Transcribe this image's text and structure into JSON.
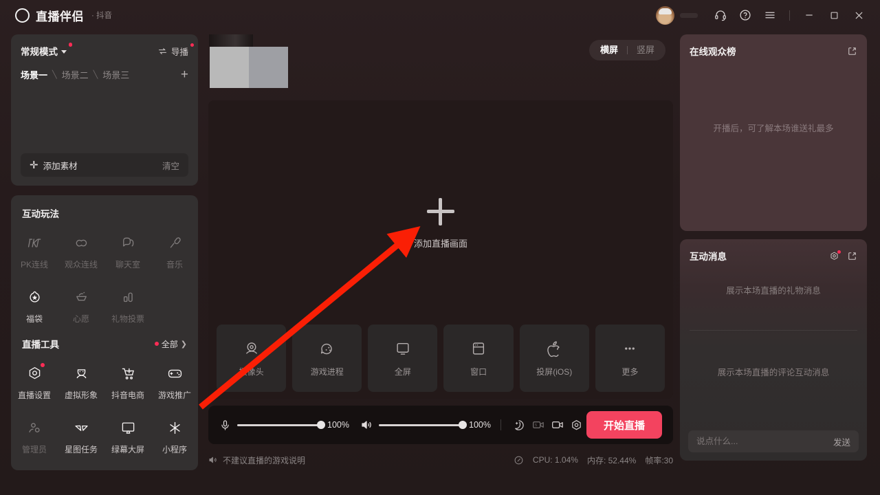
{
  "titlebar": {
    "brand": "直播伴侣",
    "brand_sub": "· 抖音",
    "icons": {
      "headset": "headset-icon",
      "help": "help-icon",
      "menu": "menu-icon",
      "minimize": "minimize-icon",
      "maximize": "maximize-icon",
      "close": "close-icon"
    }
  },
  "sidebar": {
    "mode_label": "常规模式",
    "director_label": "导播",
    "scenes": [
      {
        "label": "场景一",
        "active": true
      },
      {
        "label": "场景二",
        "active": false
      },
      {
        "label": "场景三",
        "active": false
      }
    ],
    "add_scene": "+",
    "add_source_label": "添加素材",
    "clear_label": "清空",
    "interactive": {
      "title": "互动玩法",
      "items": [
        {
          "label": "PK连线",
          "icon": "pk-icon",
          "enabled": false
        },
        {
          "label": "观众连线",
          "icon": "audience-link-icon",
          "enabled": false
        },
        {
          "label": "聊天室",
          "icon": "chatroom-icon",
          "enabled": false
        },
        {
          "label": "音乐",
          "icon": "music-icon",
          "enabled": false
        },
        {
          "label": "福袋",
          "icon": "lucky-bag-icon",
          "enabled": true
        },
        {
          "label": "心愿",
          "icon": "wish-icon",
          "enabled": false
        },
        {
          "label": "礼物投票",
          "icon": "gift-vote-icon",
          "enabled": false
        }
      ]
    },
    "tools": {
      "title": "直播工具",
      "all_label": "全部",
      "items": [
        {
          "label": "直播设置",
          "icon": "live-settings-icon",
          "enabled": true,
          "badge": true
        },
        {
          "label": "虚拟形象",
          "icon": "avatar-icon",
          "enabled": true,
          "badge": false
        },
        {
          "label": "抖音电商",
          "icon": "shop-cart-icon",
          "enabled": true,
          "badge": false
        },
        {
          "label": "游戏推广",
          "icon": "gamepad-icon",
          "enabled": true,
          "badge": false
        },
        {
          "label": "管理员",
          "icon": "admin-icon",
          "enabled": false,
          "badge": false
        },
        {
          "label": "星图任务",
          "icon": "star-task-icon",
          "enabled": true,
          "badge": false
        },
        {
          "label": "绿幕大屏",
          "icon": "greenscreen-icon",
          "enabled": true,
          "badge": false
        },
        {
          "label": "小程序",
          "icon": "miniapp-icon",
          "enabled": true,
          "badge": false
        }
      ]
    }
  },
  "preview": {
    "orientation": {
      "landscape": "横屏",
      "portrait": "竖屏",
      "active": "横屏"
    },
    "stage_hint": "添加直播画面",
    "sources": [
      {
        "label": "摄像头",
        "icon": "webcam-icon"
      },
      {
        "label": "游戏进程",
        "icon": "game-process-icon"
      },
      {
        "label": "全屏",
        "icon": "fullscreen-icon"
      },
      {
        "label": "窗口",
        "icon": "window-icon"
      },
      {
        "label": "投屏(iOS)",
        "icon": "apple-airplay-icon"
      },
      {
        "label": "更多",
        "icon": "more-icon"
      }
    ]
  },
  "controls": {
    "mic_icon": "microphone-icon",
    "mic_value": "100%",
    "speaker_icon": "speaker-icon",
    "speaker_value": "100%",
    "icons": [
      {
        "name": "beauty-icon",
        "enabled": true
      },
      {
        "name": "replay-5s-icon",
        "enabled": false
      },
      {
        "name": "video-icon",
        "enabled": true
      },
      {
        "name": "settings-gear-icon",
        "enabled": true
      }
    ],
    "go_live_label": "开始直播"
  },
  "status": {
    "notice_icon": "speaker-mute-icon",
    "notice": "不建议直播的游戏说明",
    "perf_icon": "perf-icon",
    "cpu": "CPU: 1.04%",
    "memory": "内存: 52.44%",
    "fps": "帧率:30"
  },
  "right_panel": {
    "viewers": {
      "title": "在线观众榜",
      "popout_icon": "popout-icon",
      "empty": "开播后，可了解本场谁送礼最多"
    },
    "messages": {
      "title": "互动消息",
      "settings_icon": "settings-gear-icon",
      "popout_icon": "popout-icon",
      "empty_gift": "展示本场直播的礼物消息",
      "empty_comment": "展示本场直播的评论互动消息",
      "chat_placeholder": "说点什么...",
      "send_label": "发送"
    }
  },
  "annotation": {
    "arrow_color": "#fa1f05"
  },
  "colors": {
    "accent": "#fe2c55",
    "go_live": "#f3435f",
    "card": "#333030",
    "panel_warm": "#4a3639",
    "stage": "#231919"
  }
}
